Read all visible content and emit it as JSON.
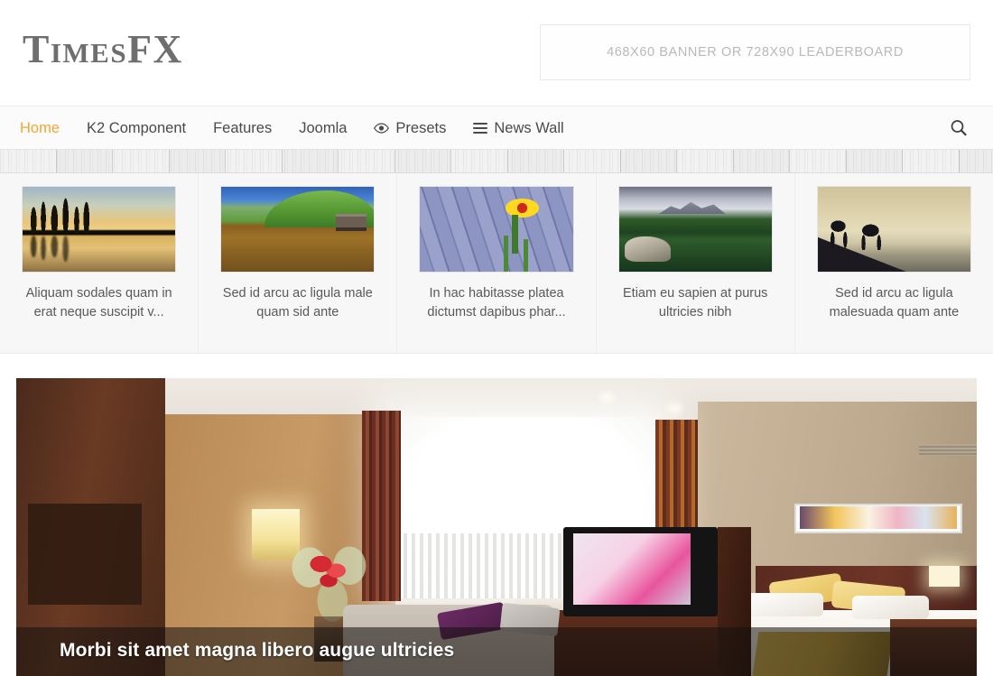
{
  "header": {
    "logo": "TimesFX",
    "banner_text": "468x60 BANNER OR 728x90 LEADERBOARD"
  },
  "nav": {
    "items": [
      {
        "label": "Home",
        "icon": "",
        "active": true
      },
      {
        "label": "K2 Component",
        "icon": "",
        "active": false
      },
      {
        "label": "Features",
        "icon": "",
        "active": false
      },
      {
        "label": "Joomla",
        "icon": "",
        "active": false
      },
      {
        "label": "Presets",
        "icon": "eye-icon",
        "active": false
      },
      {
        "label": "News Wall",
        "icon": "hamburger-icon",
        "active": false
      }
    ],
    "search_icon": "search-icon",
    "active_color": "#f0a830"
  },
  "thumbstrip": {
    "items": [
      {
        "title": "Aliquam sodales quam in erat neque suscipit v...",
        "image": "sunset-lake-pine-trees"
      },
      {
        "title": "Sed id arcu ac ligula male quam sid ante",
        "image": "green-hill-boathouse-lake"
      },
      {
        "title": "In hac habitasse platea dictumst dapibus phar...",
        "image": "yellow-flower-wooden-planks"
      },
      {
        "title": "Etiam eu sapien at purus ultricies nibh",
        "image": "alpine-lake-forest-mountains"
      },
      {
        "title": "Sed id arcu ac ligula malesuada quam ante",
        "image": "camels-desert-dune-silhouette"
      }
    ]
  },
  "featured": {
    "caption": "Morbi sit amet magna libero augue ultricies",
    "image": "hotel-room-interior-bed-tv"
  }
}
